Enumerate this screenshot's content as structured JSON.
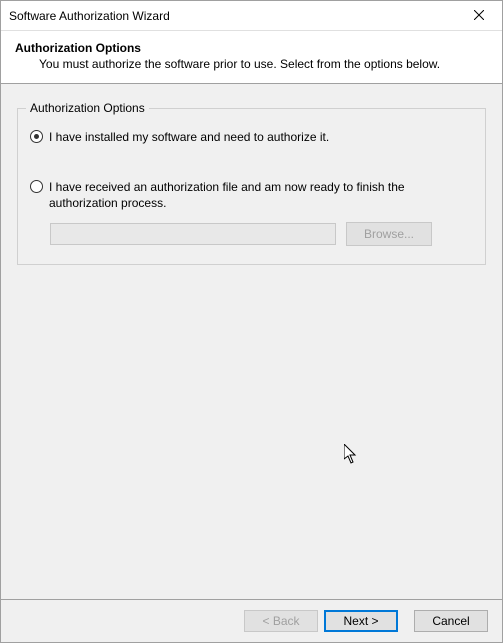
{
  "window": {
    "title": "Software Authorization Wizard"
  },
  "header": {
    "title": "Authorization Options",
    "subtitle": "You must authorize the software prior to use. Select from the options below."
  },
  "group": {
    "legend": "Authorization Options",
    "option1": "I have installed my software and need to authorize it.",
    "option2": "I have received an authorization file and am now ready to finish the authorization process.",
    "browse": "Browse...",
    "file_value": ""
  },
  "footer": {
    "back": "< Back",
    "next": "Next >",
    "cancel": "Cancel"
  }
}
